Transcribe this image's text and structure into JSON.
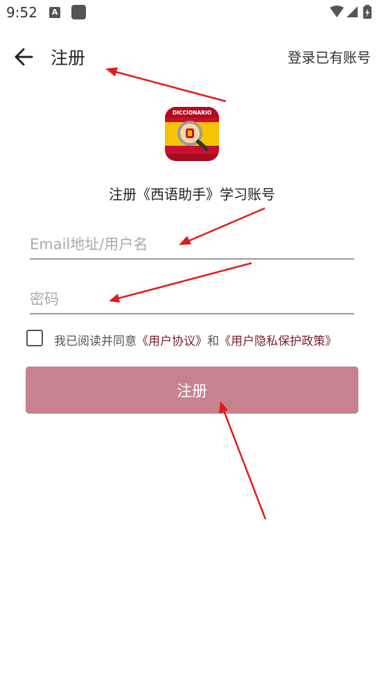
{
  "status_bar": {
    "time": "9:52",
    "notification_icon_letter": "A"
  },
  "app_bar": {
    "title": "注册",
    "login_link": "登录已有账号"
  },
  "logo": {
    "label": "DICCIONARIO"
  },
  "subtitle": "注册《西语助手》学习账号",
  "form": {
    "email_placeholder": "Email地址/用户名",
    "email_value": "",
    "password_placeholder": "密码",
    "password_value": ""
  },
  "agreement": {
    "checked": false,
    "prefix": "我已阅读并同意",
    "user_agreement": "《用户协议》",
    "and": "和",
    "privacy_policy": "《用户隐私保护政策》"
  },
  "register_button": "注册",
  "colors": {
    "accent": "#c8828f",
    "link": "#7a1e2c",
    "annotation_arrow": "#e01b1b",
    "logo_red": "#c8102e",
    "logo_yellow": "#f5c400"
  },
  "icons": [
    "back-arrow-icon",
    "wifi-icon",
    "signal-icon",
    "battery-icon",
    "dictionary-logo-icon"
  ]
}
